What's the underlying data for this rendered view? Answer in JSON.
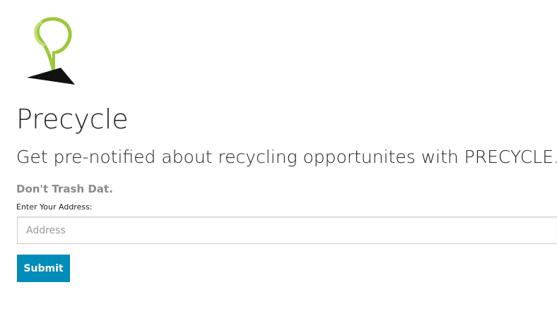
{
  "header": {
    "logo_icon": "sprout-logo-icon",
    "logo_colors": {
      "leaf": "#9cc83a",
      "ground": "#111111"
    }
  },
  "main": {
    "title": "Precycle",
    "subtitle": "Get pre-notified about recycling opportunites with PRECYCLE.",
    "tagline": "Don't Trash Dat."
  },
  "form": {
    "address_label": "Enter Your Address:",
    "address_placeholder": "Address",
    "address_value": "",
    "submit_label": "Submit"
  },
  "colors": {
    "accent": "#008cba",
    "tagline": "#8a8a8a"
  }
}
